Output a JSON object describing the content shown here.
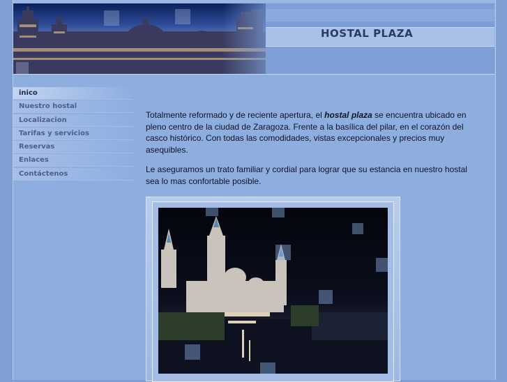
{
  "header": {
    "site_title": "HOSTAL PLAZA",
    "banner_image": "basilica-del-pilar-panorama",
    "colors": {
      "background": "#7f9fd2",
      "panel": "#8eaee0",
      "title": "#2c3a63",
      "text": "#0e1424"
    }
  },
  "nav": {
    "items": [
      {
        "label": "inico",
        "active": true
      },
      {
        "label": "Nuestro hostal",
        "active": false
      },
      {
        "label": "Localizacion",
        "active": false
      },
      {
        "label": "Tarifas y servicios",
        "active": false
      },
      {
        "label": "Reservas",
        "active": false
      },
      {
        "label": "Enlaces",
        "active": false
      },
      {
        "label": "Contáctenos",
        "active": false
      }
    ]
  },
  "content": {
    "p1_before": "Totalmente reformado y de reciente apertura, el ",
    "p1_emphasis": "hostal plaza",
    "p1_after": " se encuentra ubicado en pleno centro de la ciudad de Zaragoza. Frente a la basílica del pilar, en el corazón del casco histórico. Con todas las comodidades, vistas excepcionales y precios muy asequibles.",
    "p2": "Le aseguramos un trato familiar y cordial para lograr que su estancia en nuestro hostal sea lo mas confortable posible.",
    "photo": "basilica-del-pilar-night"
  }
}
